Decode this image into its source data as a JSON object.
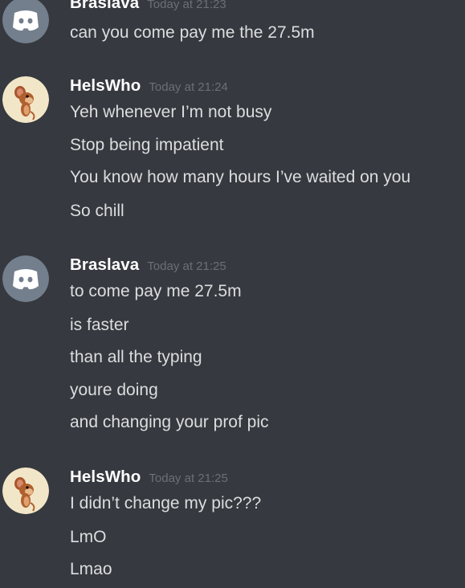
{
  "groups": [
    {
      "author": "Braslava",
      "timestamp": "Today at 21:23",
      "avatar": "discord-default-avatar",
      "messages": [
        "can you come pay me the 27.5m"
      ]
    },
    {
      "author": "HelsWho",
      "timestamp": "Today at 21:24",
      "avatar": "jerry-mouse-avatar",
      "messages": [
        "Yeh whenever I’m not busy",
        "Stop being impatient",
        "You know how many hours I’ve waited on you",
        "So chill"
      ]
    },
    {
      "author": "Braslava",
      "timestamp": "Today at 21:25",
      "avatar": "discord-default-avatar",
      "messages": [
        "to come pay me 27.5m",
        "is faster",
        "than all the typing",
        "youre doing",
        "and changing your prof pic"
      ]
    },
    {
      "author": "HelsWho",
      "timestamp": "Today at 21:25",
      "avatar": "jerry-mouse-avatar",
      "messages": [
        "I didn’t change my pic???",
        "LmO",
        "Lmao"
      ]
    }
  ],
  "colors": {
    "background": "#36393f",
    "author": "#ffffff",
    "timestamp": "#6c6f75",
    "message": "#dcddde",
    "discord_avatar_bg": "#747f8d",
    "jerry_avatar_bg": "#f2e6c8"
  }
}
